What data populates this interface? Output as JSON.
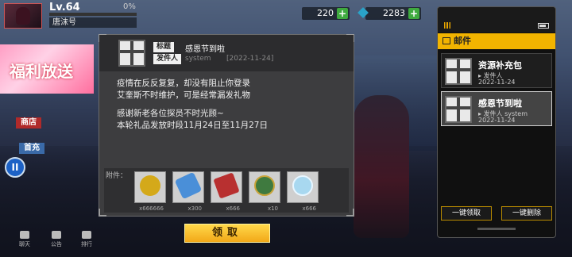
{
  "player": {
    "level": "Lv.64",
    "exp_percent": "0%",
    "name": "唐沫号"
  },
  "currencies": [
    {
      "value": "220"
    },
    {
      "value": "2283"
    }
  ],
  "left": {
    "banner_text": "福利放送",
    "tag_shop": "商店",
    "tag_new": "首充"
  },
  "bottom_nav": [
    {
      "label": "聊天"
    },
    {
      "label": "公告"
    },
    {
      "label": "排行"
    }
  ],
  "dialog": {
    "title_label": "标题",
    "title": "感恩节到啦",
    "sender_label": "发件人",
    "sender": "system",
    "date": "[2022-11-24]",
    "body": [
      "疫情在反反复复，却没有阻止你登录",
      "艾奎斯不时维护，可是经常漏发礼物",
      "",
      "感谢新老各位探员不时光顾~",
      "本轮礼品发放时段11月24日至11月27日"
    ],
    "attach_label": "附件：",
    "items": [
      {
        "icon": "gold-coin-icon",
        "count": "x666666",
        "color": "#d4a91a"
      },
      {
        "icon": "ticket-icon",
        "count": "x300",
        "color": "#4a8fd8"
      },
      {
        "icon": "red-card-icon",
        "count": "x666",
        "color": "#b83030"
      },
      {
        "icon": "badge-icon",
        "count": "x10",
        "color": "#3f7a3f"
      },
      {
        "icon": "crystal-icon",
        "count": "x666",
        "color": "#a8d8f0"
      }
    ],
    "claim_button": "领取"
  },
  "mail": {
    "header": "邮件",
    "items": [
      {
        "title": "资源补充包",
        "sender": "发件人",
        "date": "2022-11-24",
        "selected": false
      },
      {
        "title": "感恩节到啦",
        "sender": "发件人 system",
        "date": "2022-11-24",
        "selected": true
      }
    ],
    "claim_all": "一键领取",
    "delete_all": "一键删除"
  }
}
